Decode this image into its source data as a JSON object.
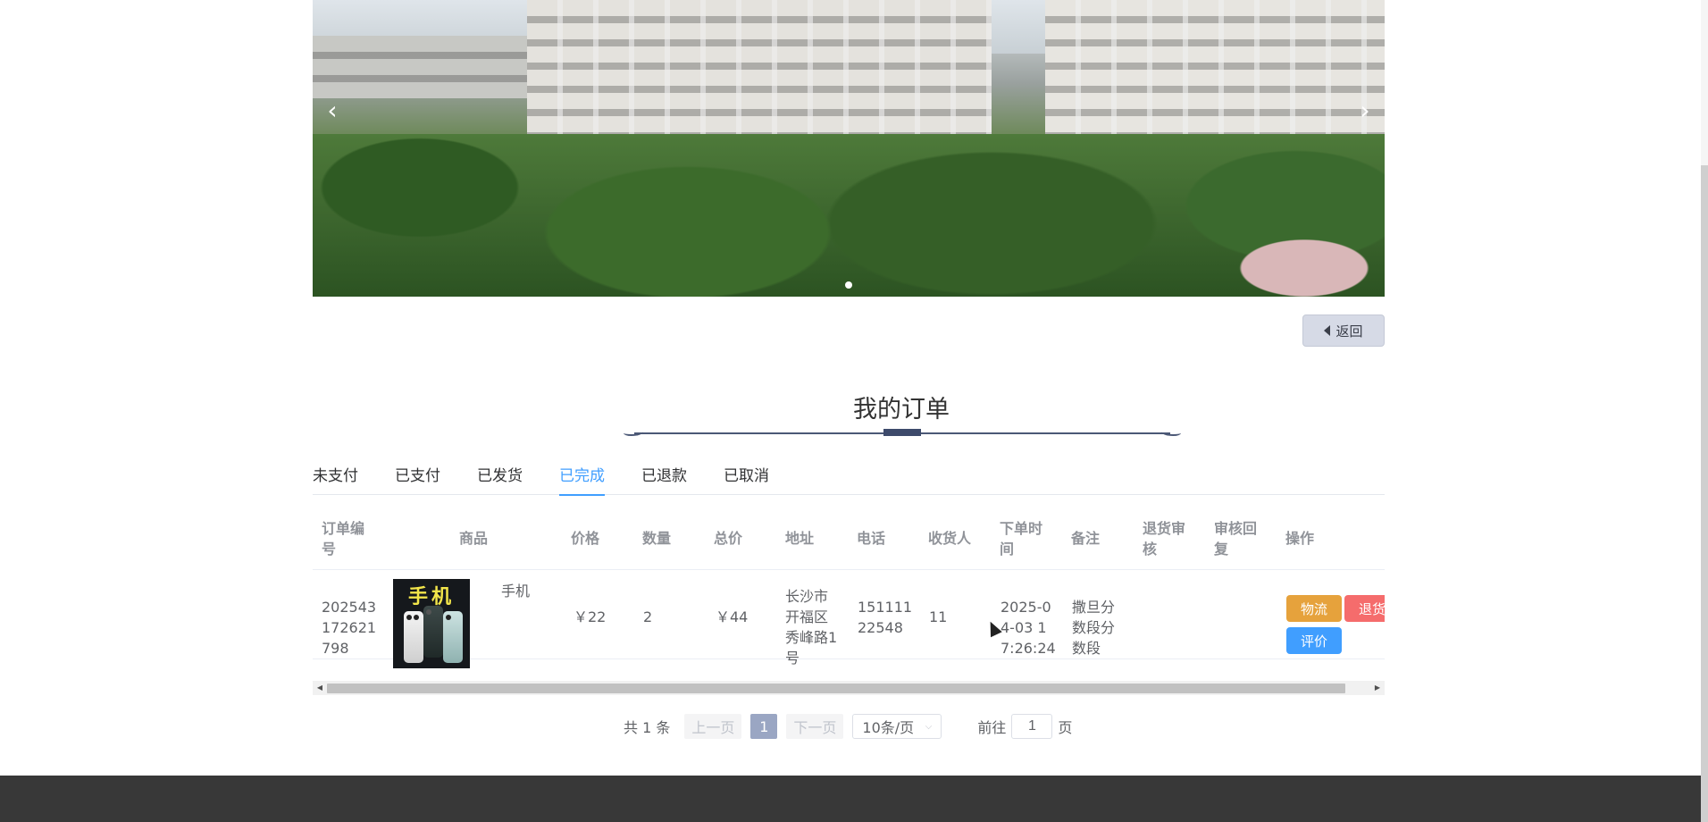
{
  "carousel": {
    "prev_icon": "chevron-left-icon",
    "next_icon": "chevron-right-icon",
    "prev_glyph": "‹",
    "next_glyph": "›"
  },
  "back_button": {
    "label": "返回",
    "icon": "caret-left-icon"
  },
  "page_title": "我的订单",
  "tabs": [
    {
      "label": "未支付",
      "active": false
    },
    {
      "label": "已支付",
      "active": false
    },
    {
      "label": "已发货",
      "active": false
    },
    {
      "label": "已完成",
      "active": true
    },
    {
      "label": "已退款",
      "active": false
    },
    {
      "label": "已取消",
      "active": false
    }
  ],
  "table": {
    "headers": [
      "订单编号",
      "商品",
      "价格",
      "数量",
      "总价",
      "地址",
      "电话",
      "收货人",
      "下单时间",
      "备注",
      "退货审核",
      "审核回复",
      "操作"
    ],
    "header_lines": {
      "order_no": [
        "订单编",
        "号"
      ],
      "order_time": [
        "下单时",
        "间"
      ],
      "return_review": [
        "退货审",
        "核"
      ],
      "review_reply": [
        "审核回",
        "复"
      ]
    },
    "rows": [
      {
        "order_no_lines": [
          "202543",
          "172621",
          "798"
        ],
        "goods_image_text": "手机",
        "goods_name": "手机",
        "price": "￥22",
        "quantity": "2",
        "total": "￥44",
        "address_lines": [
          "长沙市",
          "开福区",
          "秀峰路1",
          "号"
        ],
        "phone_lines": [
          "151111",
          "22548"
        ],
        "receiver": "11",
        "order_time_lines": [
          "2025-0",
          "4-03 1",
          "7:26:24"
        ],
        "remark_lines": [
          "撒旦分",
          "数段分",
          "数段"
        ],
        "return_review": "",
        "review_reply": "",
        "actions": {
          "logistics": "物流",
          "return": "退货",
          "review": "评价"
        }
      }
    ]
  },
  "pagination": {
    "total": "共 1 条",
    "prev": "上一页",
    "current_page": "1",
    "next": "下一页",
    "page_size": "10条/页",
    "goto_prefix": "前往",
    "goto_value": "1",
    "goto_suffix": "页"
  },
  "colors": {
    "accent": "#409eff",
    "warning": "#e6a23c",
    "danger": "#f56c6c",
    "footer": "#383838",
    "title_line": "#4b5876"
  }
}
